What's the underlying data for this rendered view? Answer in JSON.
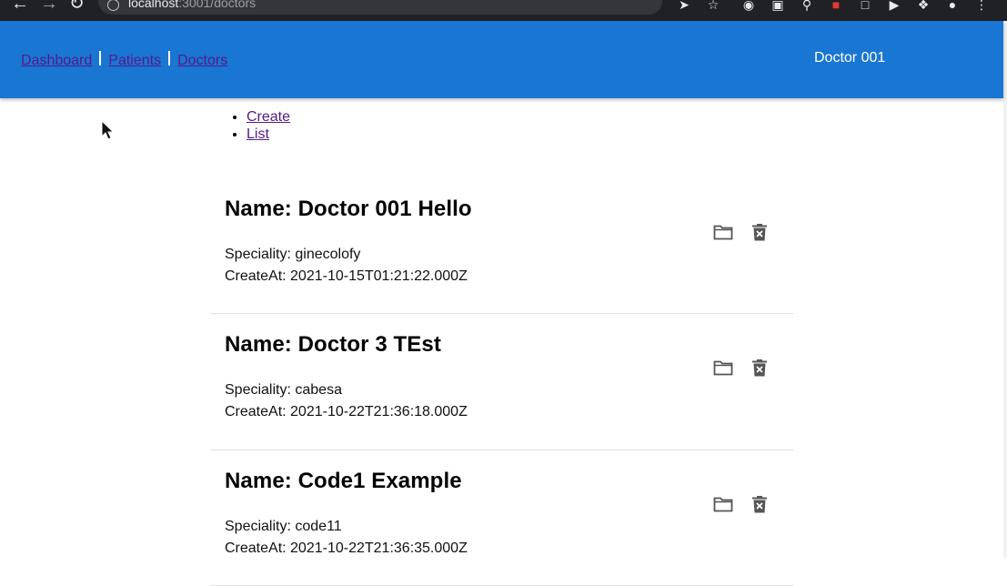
{
  "browser": {
    "url_host": "localhost",
    "url_rest": ":3001/doctors"
  },
  "appbar": {
    "links": [
      "Dashboard",
      "Patients",
      "Doctors"
    ],
    "user": "Doctor 001",
    "color": "#1976d2"
  },
  "subnav": [
    "Create",
    "List"
  ],
  "doctors": [
    {
      "name": "Name: Doctor 001 Hello",
      "speciality": "Speciality: ginecolofy",
      "created": "CreateAt: 2021-10-15T01:21:22.000Z"
    },
    {
      "name": "Name: Doctor 3 TEst",
      "speciality": "Speciality: cabesa",
      "created": "CreateAt: 2021-10-22T21:36:18.000Z"
    },
    {
      "name": "Name: Code1 Example",
      "speciality": "Speciality: code11",
      "created": "CreateAt: 2021-10-22T21:36:35.000Z"
    }
  ],
  "icons": {
    "open": "folder-open-icon",
    "delete": "delete-forever-icon"
  }
}
